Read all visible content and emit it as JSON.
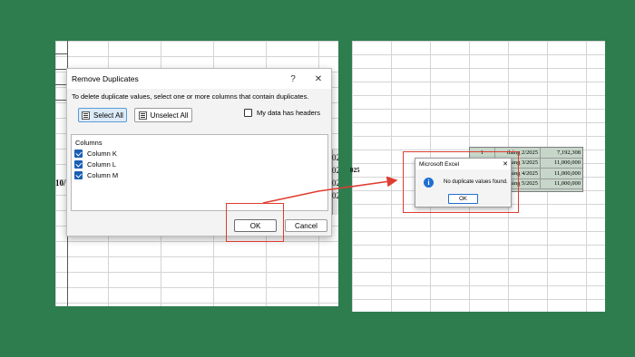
{
  "left_sheet": {
    "partial_texts": [
      "10/",
      "02",
      "02",
      "02",
      "02"
    ]
  },
  "dialog": {
    "title": "Remove Duplicates",
    "help_glyph": "?",
    "close_glyph": "✕",
    "instruction": "To delete duplicate values, select one or more columns that contain duplicates.",
    "select_all_label": "Select All",
    "unselect_all_label": "Unselect All",
    "my_data_has_headers_label": "My data has headers",
    "columns_header": "Columns",
    "columns": [
      "Column K",
      "Column L",
      "Column M"
    ],
    "ok_label": "OK",
    "cancel_label": "Cancel"
  },
  "right_sheet": {
    "side_text": "025",
    "rows": [
      {
        "c1": "1",
        "c2": "tháng 2/2025",
        "c3": "7,192,308"
      },
      {
        "c1": "",
        "c2": "tháng 3/2025",
        "c3": "11,000,000"
      },
      {
        "c1": "",
        "c2": "tháng 4/2025",
        "c3": "11,000,000"
      },
      {
        "c1": "",
        "c2": "tháng 5/2025",
        "c3": "11,000,000"
      }
    ]
  },
  "message_box": {
    "title": "Microsoft Excel",
    "close_glyph": "✕",
    "icon": "info-icon",
    "text": "No duplicate values found.",
    "ok_label": "OK"
  },
  "colors": {
    "background": "#2e7d4f",
    "highlight": "#e03c31",
    "accent": "#1f6fd0"
  }
}
